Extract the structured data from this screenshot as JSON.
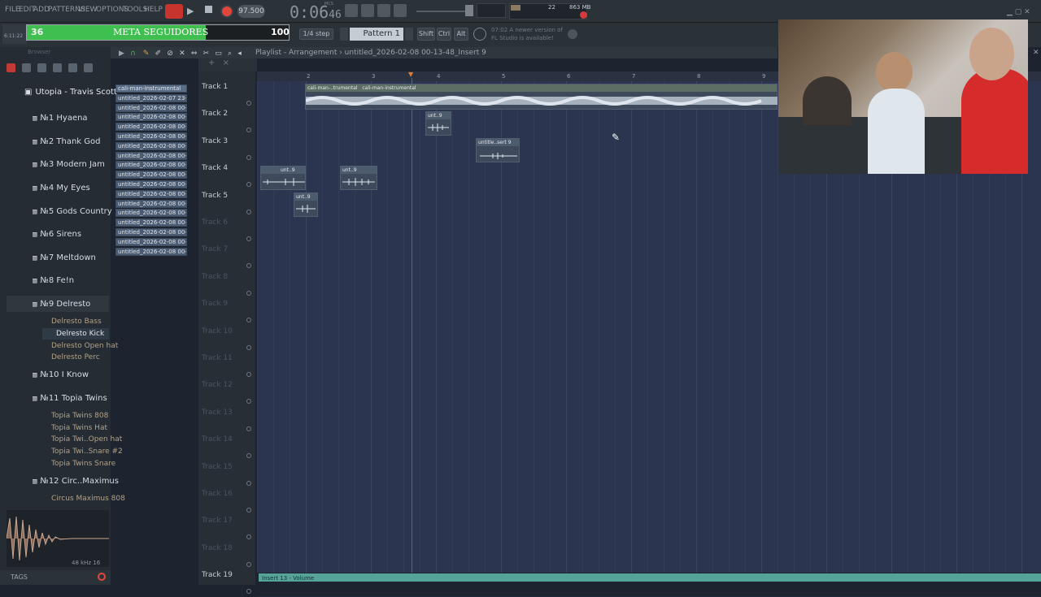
{
  "menu": [
    "FILE",
    "EDIT",
    "ADD",
    "PATTERNS",
    "VIEW",
    "OPTIONS",
    "TOOLS",
    "HELP"
  ],
  "transport": {
    "tempo": "97.500",
    "time": "0:06",
    "time_small": "46",
    "cpu": "22",
    "mem": "863 MB",
    "bars": "MCS"
  },
  "overlay": {
    "count": "36",
    "title": "META SEGUIDORES",
    "goal": "100",
    "side_label": "6:11:22"
  },
  "toolbar": {
    "step": "1/4 step",
    "pattern": "Pattern 1",
    "shift": "Shift",
    "ctrl": "Ctrl",
    "alt": "Alt",
    "hint_line1": "07:02  A newer version of",
    "hint_line2": "FL Studio is available!"
  },
  "browser": {
    "title": "Browser",
    "root": "Utopia - Travis Scott",
    "items": [
      {
        "num": "№1",
        "name": "Hyaena"
      },
      {
        "num": "№2",
        "name": "Thank God"
      },
      {
        "num": "№3",
        "name": "Modern Jam"
      },
      {
        "num": "№4",
        "name": "My Eyes"
      },
      {
        "num": "№5",
        "name": "Gods Country"
      },
      {
        "num": "№6",
        "name": "Sirens"
      },
      {
        "num": "№7",
        "name": "Meltdown"
      },
      {
        "num": "№8",
        "name": "Fe!n"
      },
      {
        "num": "№9",
        "name": "Delresto"
      },
      {
        "num": "№10",
        "name": "I Know"
      },
      {
        "num": "№11",
        "name": "Topia Twins"
      },
      {
        "num": "№12",
        "name": "Circ..Maximus"
      }
    ],
    "delresto_sub": [
      "Delresto Bass",
      "Delresto Kick",
      "Delresto Open hat",
      "Delresto Perc"
    ],
    "topia_sub": [
      "Topia Twins 808",
      "Topia Twins Hat",
      "Topia Twi..Open hat",
      "Topia Twi..Snare #2",
      "Topia Twins Snare"
    ],
    "circ_sub": [
      "Circus Maximus 808"
    ],
    "sample_info": "48 kHz 16",
    "tags": "TAGS"
  },
  "picker": [
    "cali-man-instrumental",
    "untitled_2026-02-07 23-5...",
    "untitled_2026-02-08 00-0...",
    "untitled_2026-02-08 00-0...",
    "untitled_2026-02-08 00-0...",
    "untitled_2026-02-08 00-0...",
    "untitled_2026-02-08 00-0...",
    "untitled_2026-02-08 00-0...",
    "untitled_2026-02-08 00-0...",
    "untitled_2026-02-08 00-0...",
    "untitled_2026-02-08 00-0...",
    "untitled_2026-02-08 00-0...",
    "untitled_2026-02-08 00-0...",
    "untitled_2026-02-08 00-0...",
    "untitled_2026-02-08 00-0...",
    "untitled_2026-02-08 00-10...",
    "untitled_2026-02-08 00-12...",
    "untitled_2026-02-08 00-13..."
  ],
  "playlist": {
    "breadcrumb": "Playlist - Arrangement › untitled_2026-02-08 00-13-48_Insert 9",
    "bar_numbers": [
      "2",
      "3",
      "4",
      "5",
      "6",
      "7",
      "8",
      "9"
    ],
    "tracks": [
      "Track 1",
      "Track 2",
      "Track 3",
      "Track 4",
      "Track 5",
      "Track 6",
      "Track 7",
      "Track 8",
      "Track 9",
      "Track 10",
      "Track 11",
      "Track 12",
      "Track 13",
      "Track 14",
      "Track 15",
      "Track 16",
      "Track 17",
      "Track 18",
      "Track 19"
    ],
    "clips": {
      "t1a": "cali-man-..trumental",
      "t1b": "cali-man-instrumental",
      "t2": "unt..9",
      "t3": "untitle..sert 9",
      "t4a": "unt..9",
      "t4b": "unt..9",
      "t5": "unt..9"
    },
    "automation": "Insert 13 - Volume"
  },
  "colors": {
    "accent_green": "#3fbf4f",
    "grid": "#2b3550",
    "clip": "#4d5b6e",
    "audio": "#b9c3cf",
    "brown": "#b3a287"
  }
}
